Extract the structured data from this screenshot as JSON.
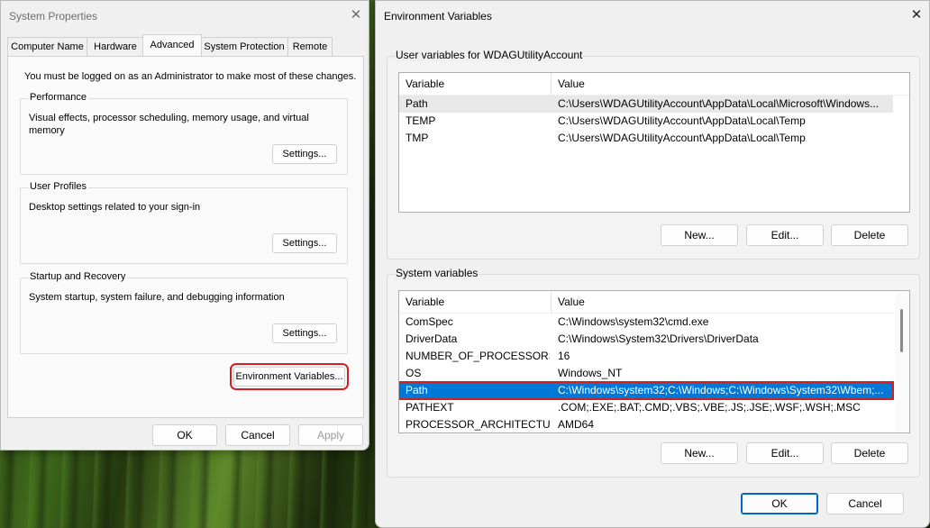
{
  "system_properties": {
    "title": "System Properties",
    "tabs": [
      "Computer Name",
      "Hardware",
      "Advanced",
      "System Protection",
      "Remote"
    ],
    "active_tab": "Advanced",
    "admin_notice": "You must be logged on as an Administrator to make most of these changes.",
    "performance": {
      "label": "Performance",
      "description": "Visual effects, processor scheduling, memory usage, and virtual memory",
      "button": "Settings..."
    },
    "user_profiles": {
      "label": "User Profiles",
      "description": "Desktop settings related to your sign-in",
      "button": "Settings..."
    },
    "startup_recovery": {
      "label": "Startup and Recovery",
      "description": "System startup, system failure, and debugging information",
      "button": "Settings..."
    },
    "env_button": "Environment Variables...",
    "ok": "OK",
    "cancel": "Cancel",
    "apply": "Apply"
  },
  "environment_variables": {
    "title": "Environment Variables",
    "user_section": {
      "label": "User variables for WDAGUtilityAccount",
      "columns": [
        "Variable",
        "Value"
      ],
      "rows": [
        {
          "variable": "Path",
          "value": "C:\\Users\\WDAGUtilityAccount\\AppData\\Local\\Microsoft\\Windows..."
        },
        {
          "variable": "TEMP",
          "value": "C:\\Users\\WDAGUtilityAccount\\AppData\\Local\\Temp"
        },
        {
          "variable": "TMP",
          "value": "C:\\Users\\WDAGUtilityAccount\\AppData\\Local\\Temp"
        }
      ],
      "new": "New...",
      "edit": "Edit...",
      "delete": "Delete"
    },
    "system_section": {
      "label": "System variables",
      "columns": [
        "Variable",
        "Value"
      ],
      "rows": [
        {
          "variable": "ComSpec",
          "value": "C:\\Windows\\system32\\cmd.exe"
        },
        {
          "variable": "DriverData",
          "value": "C:\\Windows\\System32\\Drivers\\DriverData"
        },
        {
          "variable": "NUMBER_OF_PROCESSORS",
          "value": "16"
        },
        {
          "variable": "OS",
          "value": "Windows_NT"
        },
        {
          "variable": "Path",
          "value": "C:\\Windows\\system32;C:\\Windows;C:\\Windows\\System32\\Wbem;..."
        },
        {
          "variable": "PATHEXT",
          "value": ".COM;.EXE;.BAT;.CMD;.VBS;.VBE;.JS;.JSE;.WSF;.WSH;.MSC"
        },
        {
          "variable": "PROCESSOR_ARCHITECTURE",
          "value": "AMD64"
        }
      ],
      "selected_variable": "Path",
      "new": "New...",
      "edit": "Edit...",
      "delete": "Delete"
    },
    "ok": "OK",
    "cancel": "Cancel"
  },
  "icons": {
    "close": "close-icon"
  },
  "colors": {
    "selection": "#0078d7",
    "highlight_box": "#d21f1f",
    "primary_border": "#0067c0"
  }
}
